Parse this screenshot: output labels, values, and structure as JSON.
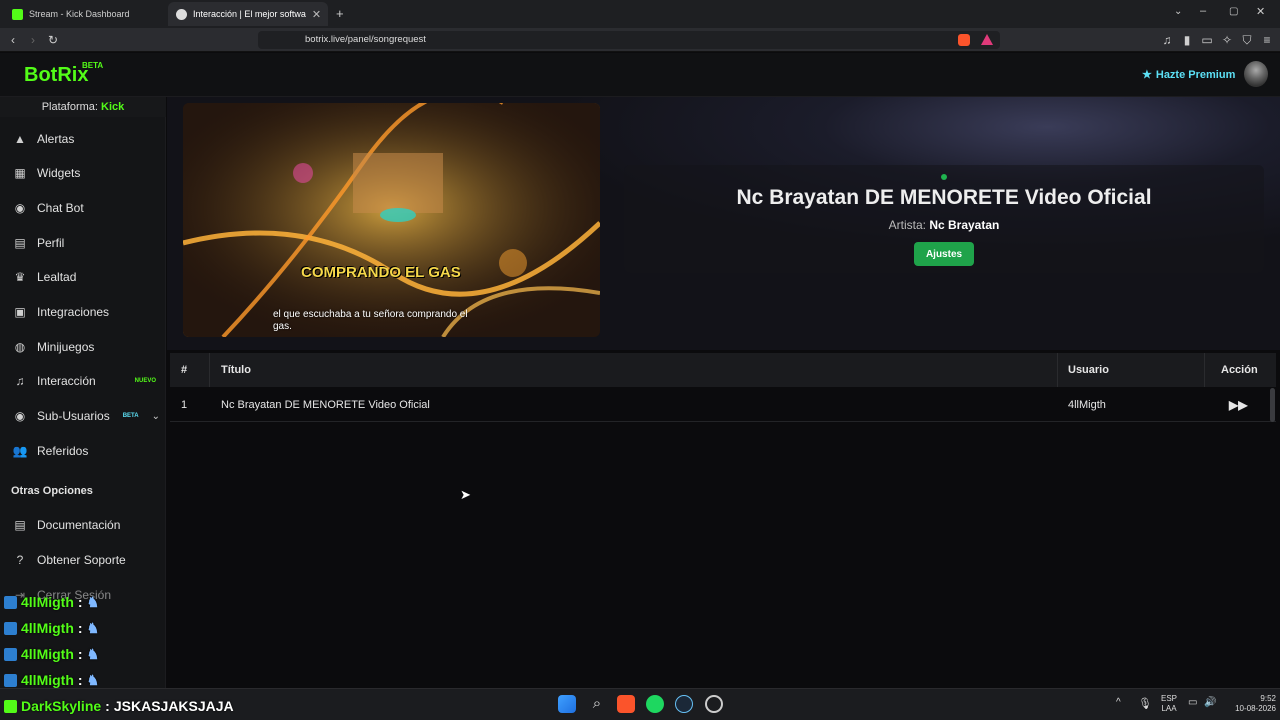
{
  "browser": {
    "tabs": [
      {
        "label": "Stream - Kick Dashboard",
        "active": false
      },
      {
        "label": "Interacción | El mejor softwa",
        "active": true
      }
    ],
    "url": "botrix.live/panel/songrequest"
  },
  "app": {
    "logo": "BotRix",
    "logo_badge": "BETA",
    "premium_label": "Hazte Premium",
    "platform_label": "Plataforma:",
    "platform_value": "Kick"
  },
  "sidebar": {
    "items": [
      {
        "label": "Alertas",
        "icon": "warning-icon"
      },
      {
        "label": "Widgets",
        "icon": "grid-icon"
      },
      {
        "label": "Chat Bot",
        "icon": "robot-icon"
      },
      {
        "label": "Perfil",
        "icon": "id-card-icon"
      },
      {
        "label": "Lealtad",
        "icon": "trophy-icon"
      },
      {
        "label": "Integraciones",
        "icon": "plug-icon"
      },
      {
        "label": "Minijuegos",
        "icon": "gamepad-icon"
      },
      {
        "label": "Interacción",
        "icon": "music-icon",
        "tag": "NUEVO"
      },
      {
        "label": "Sub-Usuarios",
        "icon": "robot-icon",
        "tag": "BETA"
      },
      {
        "label": "Referidos",
        "icon": "users-icon"
      }
    ],
    "section_title": "Otras Opciones",
    "other_items": [
      {
        "label": "Documentación",
        "icon": "document-icon"
      },
      {
        "label": "Obtener Soporte",
        "icon": "question-icon"
      },
      {
        "label": "Cerrar Sesión",
        "icon": "logout-icon"
      }
    ]
  },
  "player": {
    "video_caption_overlay": "COMPRANDO EL GAS",
    "subtitle": "el que escuchaba a tu señora comprando el gas.",
    "song_title": "Nc Brayatan DE MENORETE Video Oficial",
    "artist_label": "Artista:",
    "artist_value": "Nc Brayatan",
    "settings_button": "Ajustes"
  },
  "queue": {
    "headers": [
      "#",
      "Título",
      "Usuario",
      "Acción"
    ],
    "rows": [
      {
        "num": "1",
        "title": "Nc Brayatan DE MENORETE Video Oficial",
        "user": "4llMigth"
      }
    ]
  },
  "chat_overlay": [
    {
      "user": "4llMigth",
      "msg": ""
    },
    {
      "user": "4llMigth",
      "msg": ""
    },
    {
      "user": "4llMigth",
      "msg": ""
    },
    {
      "user": "4llMigth",
      "msg": ""
    },
    {
      "user": "DarkSkyline",
      "msg": "JSKASJAKSJAJA"
    }
  ],
  "taskbar": {
    "lang": "ESP",
    "lang_sub": "LAA",
    "time": "9:52",
    "date": "10-08-2026"
  }
}
